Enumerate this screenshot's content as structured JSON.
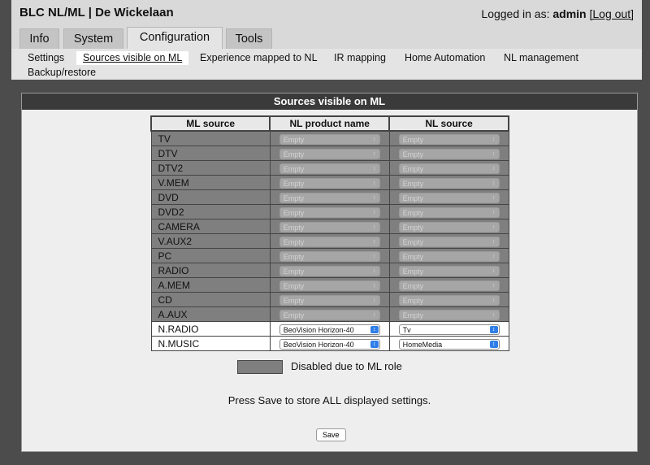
{
  "header": {
    "title": "BLC NL/ML | De Wickelaan",
    "login_prefix": "Logged in as:",
    "username": "admin",
    "logout_label": "[Log out]"
  },
  "tabs": [
    {
      "label": "Info"
    },
    {
      "label": "System"
    },
    {
      "label": "Configuration",
      "active": true
    },
    {
      "label": "Tools"
    }
  ],
  "subnav": [
    {
      "label": "Settings"
    },
    {
      "label": "Sources visible on ML",
      "active": true
    },
    {
      "label": "Experience mapped to NL"
    },
    {
      "label": "IR mapping"
    },
    {
      "label": "Home Automation"
    },
    {
      "label": "NL management"
    },
    {
      "label": "Backup/restore"
    }
  ],
  "panel": {
    "title": "Sources visible on ML",
    "columns": [
      "ML source",
      "NL product name",
      "NL source"
    ],
    "rows": [
      {
        "ml": "TV",
        "product": "Empty",
        "source": "Empty",
        "disabled": true
      },
      {
        "ml": "DTV",
        "product": "Empty",
        "source": "Empty",
        "disabled": true
      },
      {
        "ml": "DTV2",
        "product": "Empty",
        "source": "Empty",
        "disabled": true
      },
      {
        "ml": "V.MEM",
        "product": "Empty",
        "source": "Empty",
        "disabled": true
      },
      {
        "ml": "DVD",
        "product": "Empty",
        "source": "Empty",
        "disabled": true
      },
      {
        "ml": "DVD2",
        "product": "Empty",
        "source": "Empty",
        "disabled": true
      },
      {
        "ml": "CAMERA",
        "product": "Empty",
        "source": "Empty",
        "disabled": true
      },
      {
        "ml": "V.AUX2",
        "product": "Empty",
        "source": "Empty",
        "disabled": true
      },
      {
        "ml": "PC",
        "product": "Empty",
        "source": "Empty",
        "disabled": true
      },
      {
        "ml": "RADIO",
        "product": "Empty",
        "source": "Empty",
        "disabled": true
      },
      {
        "ml": "A.MEM",
        "product": "Empty",
        "source": "Empty",
        "disabled": true
      },
      {
        "ml": "CD",
        "product": "Empty",
        "source": "Empty",
        "disabled": true
      },
      {
        "ml": "A.AUX",
        "product": "Empty",
        "source": "Empty",
        "disabled": true
      },
      {
        "ml": "N.RADIO",
        "product": "BeoVision Horizon-40",
        "source": "Tv",
        "disabled": false
      },
      {
        "ml": "N.MUSIC",
        "product": "BeoVision Horizon-40",
        "source": "HomeMedia",
        "disabled": false
      }
    ],
    "legend_label": "Disabled due to ML role",
    "note": "Press Save to store ALL displayed settings.",
    "save_label": "Save"
  },
  "colors": {
    "disabled_row": "#7f7f7f",
    "panel_title_bg": "#3a3a3a",
    "select_arrow": "#2f7ee8"
  },
  "icons": {
    "select_arrow": "chevron-up-down-icon"
  }
}
